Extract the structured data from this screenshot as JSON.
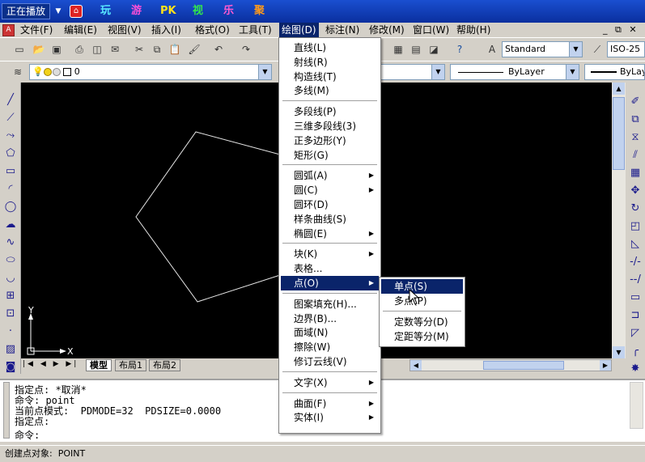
{
  "top_bar": {
    "now_playing": "正在播放",
    "links": [
      {
        "label": "玩",
        "color": "#58e8ff"
      },
      {
        "label": "游",
        "color": "#ff4fd8"
      },
      {
        "label": "PK",
        "color": "#ffe21a"
      },
      {
        "label": "视",
        "color": "#33e84a"
      },
      {
        "label": "乐",
        "color": "#ff5ad0"
      },
      {
        "label": "聚",
        "color": "#ff9a1a"
      }
    ]
  },
  "menubar": [
    "文件(F)",
    "编辑(E)",
    "视图(V)",
    "插入(I)",
    "格式(O)",
    "工具(T)",
    "绘图(D)",
    "标注(N)",
    "修改(M)",
    "窗口(W)",
    "帮助(H)"
  ],
  "window_controls": [
    "_",
    "⧉",
    "✕"
  ],
  "toolbar": {
    "text_style": "Standard",
    "dim_style": "ISO-25",
    "layer": "0",
    "color": "ByLayer",
    "linetype": "ByLayer",
    "lineweight": "ByLay"
  },
  "draw_menu": {
    "items": [
      {
        "label": "直线(L)",
        "sub": false
      },
      {
        "label": "射线(R)",
        "sub": false
      },
      {
        "label": "构造线(T)",
        "sub": false
      },
      {
        "label": "多线(M)",
        "sub": false
      },
      {
        "sep": true
      },
      {
        "label": "多段线(P)",
        "sub": false
      },
      {
        "label": "三维多段线(3)",
        "sub": false
      },
      {
        "label": "正多边形(Y)",
        "sub": false
      },
      {
        "label": "矩形(G)",
        "sub": false
      },
      {
        "sep": true
      },
      {
        "label": "圆弧(A)",
        "sub": true
      },
      {
        "label": "圆(C)",
        "sub": true
      },
      {
        "label": "圆环(D)",
        "sub": false
      },
      {
        "label": "样条曲线(S)",
        "sub": false
      },
      {
        "label": "椭圆(E)",
        "sub": true
      },
      {
        "sep": true
      },
      {
        "label": "块(K)",
        "sub": true
      },
      {
        "label": "表格...",
        "sub": false
      },
      {
        "label": "点(O)",
        "sub": true,
        "selected": true
      },
      {
        "sep": true
      },
      {
        "label": "图案填充(H)...",
        "sub": false
      },
      {
        "label": "边界(B)...",
        "sub": false
      },
      {
        "label": "面域(N)",
        "sub": false
      },
      {
        "label": "擦除(W)",
        "sub": false
      },
      {
        "label": "修订云线(V)",
        "sub": false
      },
      {
        "sep": true
      },
      {
        "label": "文字(X)",
        "sub": true
      },
      {
        "sep": true
      },
      {
        "label": "曲面(F)",
        "sub": true
      },
      {
        "label": "实体(I)",
        "sub": true
      }
    ]
  },
  "point_menu": {
    "items": [
      {
        "label": "单点(S)",
        "selected": true
      },
      {
        "label": "多点(P)"
      },
      {
        "sep": true
      },
      {
        "label": "定数等分(D)"
      },
      {
        "label": "定距等分(M)"
      }
    ]
  },
  "layout_tabs": [
    "模型",
    "布局1",
    "布局2"
  ],
  "ucs": {
    "x_label": "X",
    "y_label": "Y"
  },
  "command_history": [
    "指定点: *取消*",
    "命令: point",
    "当前点模式:  PDMODE=32  PDSIZE=0.0000",
    "指定点:"
  ],
  "command_prompt": "命令:",
  "status_text": "创建点对象:  POINT",
  "colors": {
    "accent": "#0a246a",
    "canvas": "#000000",
    "entity": "#e6e6e6"
  }
}
